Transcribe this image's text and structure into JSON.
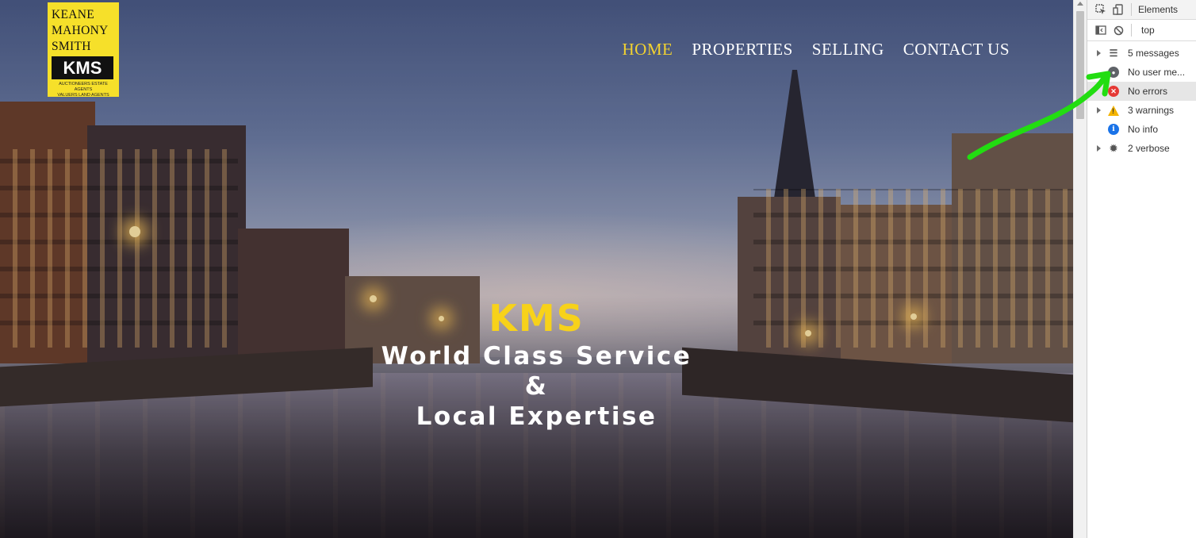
{
  "logo": {
    "line1": "KEANE",
    "line2": "MAHONY",
    "line3": "SMITH",
    "box": "KMS",
    "tag1": "AUCTIONEERS  ESTATE AGENTS",
    "tag2": "VALUERS    LAND AGENTS"
  },
  "nav": {
    "items": [
      "HOME",
      "PROPERTIES",
      "SELLING",
      "CONTACT US"
    ],
    "active_color": "#f2d230"
  },
  "hero": {
    "brand": "KMS",
    "line1": "World Class Service",
    "line2": "&",
    "line3": "Local Expertise",
    "brand_color": "#f7d21a"
  },
  "devtools": {
    "tab": "Elements",
    "context": "top",
    "items": [
      {
        "label": "5 messages",
        "icon": "list-icon",
        "expandable": true
      },
      {
        "label": "No user me...",
        "icon": "user-icon",
        "expandable": false
      },
      {
        "label": "No errors",
        "icon": "error-icon",
        "expandable": false,
        "selected": true
      },
      {
        "label": "3 warnings",
        "icon": "warning-icon",
        "expandable": true
      },
      {
        "label": "No info",
        "icon": "info-icon",
        "expandable": false
      },
      {
        "label": "2 verbose",
        "icon": "bug-icon",
        "expandable": true
      }
    ]
  },
  "annotation": {
    "color": "#22dd11"
  }
}
